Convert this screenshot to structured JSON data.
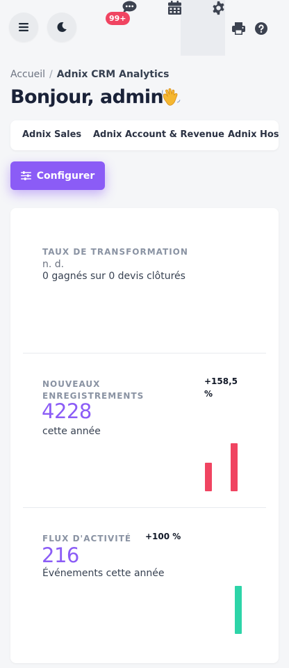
{
  "topbar": {
    "notifications_badge": "99+",
    "icons": [
      "menu-icon",
      "moon-icon",
      "chat-icon",
      "calendar-icon",
      "gear-icon",
      "printer-icon",
      "help-icon"
    ]
  },
  "breadcrumb": {
    "root": "Accueil",
    "separator": "/",
    "current": "Adnix CRM Analytics"
  },
  "greeting": {
    "text": "Bonjour, admin",
    "emoji": "👋"
  },
  "tabs": [
    {
      "label": "Adnix Sales"
    },
    {
      "label": "Adnix Account & Revenue"
    },
    {
      "label": "Adnix Hospitality"
    }
  ],
  "configure_button": {
    "label": "Configurer"
  },
  "kpis": {
    "conversion": {
      "title": "TAUX DE TRANSFORMATION",
      "value": "n. d.",
      "subtitle": "0 gagnés sur 0 devis clôturés"
    },
    "registrations": {
      "title_line1": "NOUVEAUX",
      "title_line2": "ENREGISTREMENTS",
      "value": "4228",
      "subtitle": "cette année",
      "change_line1": "+158,5",
      "change_line2": "%",
      "bars": [
        0.6,
        1.0
      ]
    },
    "activity": {
      "title": "FLUX D'ACTIVITÉ",
      "value": "216",
      "subtitle": "Événements cette année",
      "change": "+100 %",
      "bars": [
        1.0
      ]
    }
  },
  "colors": {
    "accent": "#8b5cf6",
    "bar_red": "#f04461",
    "bar_teal": "#2dd4a8",
    "badge": "#f04461"
  }
}
